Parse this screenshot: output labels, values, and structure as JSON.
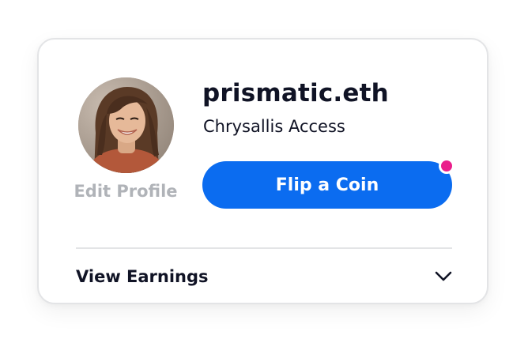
{
  "profile": {
    "username": "prismatic.eth",
    "tier": "Chrysallis Access",
    "edit_label": "Edit Profile",
    "avatar_icon": "user-avatar-photo"
  },
  "actions": {
    "flip_label": "Flip a Coin",
    "notification_indicator": true
  },
  "earnings": {
    "label": "View Earnings",
    "expand_icon": "chevron-down-icon",
    "expanded": false
  },
  "colors": {
    "accent": "#0b6cf0",
    "notification": "#ea1e8b",
    "text_primary": "#101325",
    "text_muted": "#b0b3b8",
    "border": "#e3e4e6"
  }
}
